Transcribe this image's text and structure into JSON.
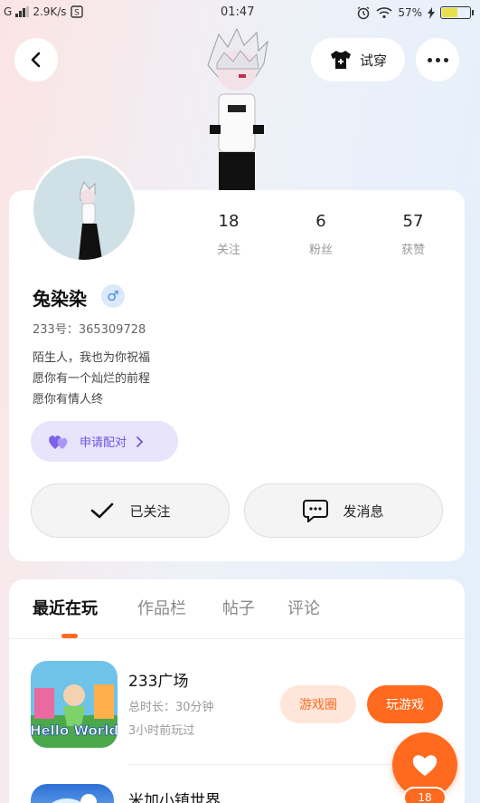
{
  "status_bar": {
    "carrier": "G",
    "net_speed": "2.9K/s",
    "time": "01:47",
    "battery_percent": "57%",
    "battery_level": 0.57
  },
  "header": {
    "back_icon": "chevron-left-icon",
    "tryon_label": "试穿",
    "more_icon": "more-dots-icon"
  },
  "stats": [
    {
      "value": "18",
      "label": "关注"
    },
    {
      "value": "6",
      "label": "粉丝"
    },
    {
      "value": "57",
      "label": "获赞"
    }
  ],
  "profile": {
    "name": "兔染染",
    "gender_symbol": "♂",
    "uid": "233号：365309728",
    "bio_lines": [
      "陌生人，我也为你祝福",
      "愿你有一个灿烂的前程",
      "愿你有情人终"
    ],
    "pair_label": "申请配对",
    "follow_label": "已关注",
    "message_label": "发消息"
  },
  "tabs": [
    "最近在玩",
    "作品栏",
    "帖子",
    "评论"
  ],
  "games": [
    {
      "title": "233广场",
      "icon_text": "Hello World",
      "duration": "总时长：30分钟",
      "last_played": "3小时前玩过",
      "circle_label": "游戏圈",
      "play_label": "玩游戏"
    },
    {
      "title": "米加小镇世界"
    }
  ],
  "like": {
    "count": "18"
  },
  "colors": {
    "accent": "#ff6a1f",
    "accent_light": "#ffe6da",
    "pair_bg": "#e8e4fb",
    "pair_text": "#6b56e0",
    "gender": "#3f8be3"
  }
}
